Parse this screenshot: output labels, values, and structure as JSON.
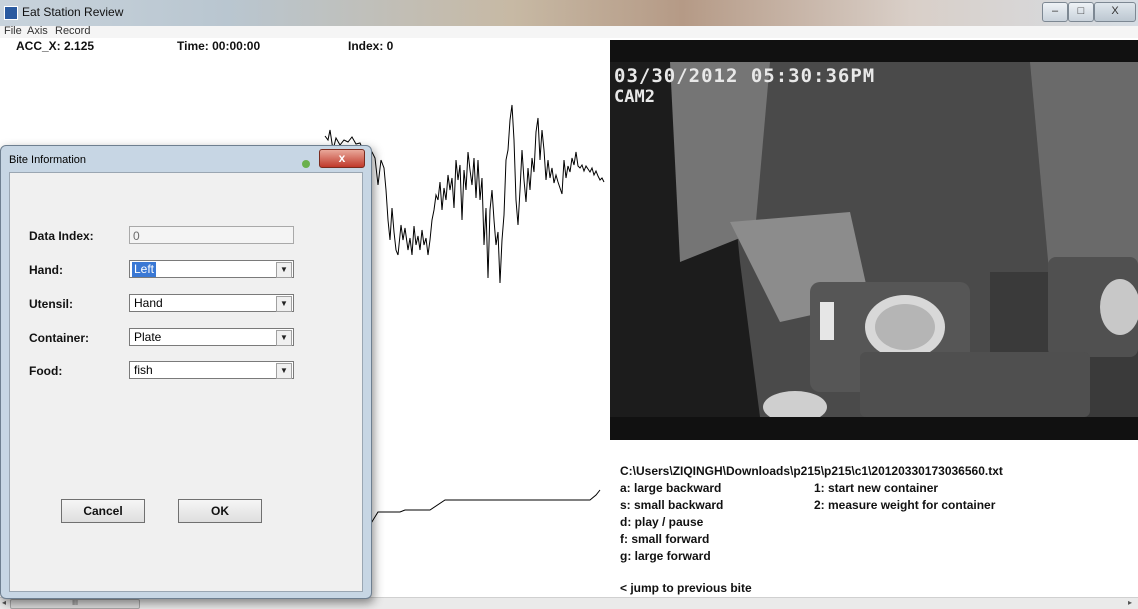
{
  "window": {
    "title": "Eat Station Review",
    "minimize": "–",
    "maximize": "□",
    "close": "X"
  },
  "menu": [
    "File",
    "Axis",
    "Record"
  ],
  "readouts": {
    "acc": "ACC_X:  2.125",
    "time": "Time: 00:00:00",
    "index": "Index: 0"
  },
  "video": {
    "timestamp": "03/30/2012 05:30:36PM",
    "camera": "CAM2"
  },
  "file_path": "C:\\Users\\ZIQINGH\\Downloads\\p215\\p215\\c1\\20120330173036560.txt",
  "help_left": [
    "a: large backward",
    "s: small backward",
    "d: play / pause",
    "f: small forward",
    "g: large forward"
  ],
  "help_right": [
    "1: start new container",
    "2: measure weight for container"
  ],
  "jump_back": "<  jump to previous bite",
  "dialog": {
    "title": "Bite Information",
    "close": "x",
    "data_index_label": "Data Index:",
    "data_index_value": "0",
    "hand_label": "Hand:",
    "hand_value": "Left",
    "utensil_label": "Utensil:",
    "utensil_value": "Hand",
    "container_label": "Container:",
    "container_value": "Plate",
    "food_label": "Food:",
    "food_value": "fish",
    "cancel": "Cancel",
    "ok": "OK"
  },
  "scrollbar": {
    "thumb": "III",
    "left_arrow": "◂",
    "right_arrow": "▸"
  },
  "colors": {
    "dialog_frame": "#c7d6e4",
    "selection": "#3a78d4",
    "close_red": "#c0392b"
  }
}
